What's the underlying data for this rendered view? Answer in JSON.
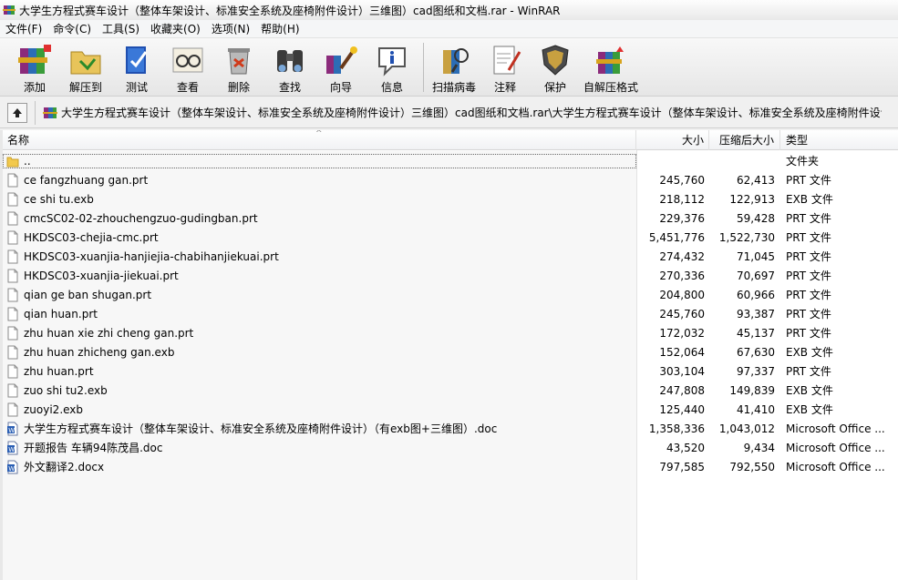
{
  "window": {
    "title": "大学生方程式赛车设计（整体车架设计、标准安全系统及座椅附件设计）三维图）cad图纸和文档.rar - WinRAR",
    "app_icon": "winrar-books-icon"
  },
  "menu": [
    "文件(F)",
    "命令(C)",
    "工具(S)",
    "收藏夹(O)",
    "选项(N)",
    "帮助(H)"
  ],
  "toolbar": {
    "buttons": [
      {
        "label": "添加",
        "icon": "add-books-icon"
      },
      {
        "label": "解压到",
        "icon": "extract-folder-icon"
      },
      {
        "label": "测试",
        "icon": "test-book-icon"
      },
      {
        "label": "查看",
        "icon": "view-glasses-icon"
      },
      {
        "label": "删除",
        "icon": "delete-recycle-icon"
      },
      {
        "label": "查找",
        "icon": "find-binoculars-icon"
      },
      {
        "label": "向导",
        "icon": "wizard-icon"
      },
      {
        "label": "信息",
        "icon": "info-icon"
      }
    ],
    "buttons2": [
      {
        "label": "扫描病毒",
        "icon": "scan-virus-icon"
      },
      {
        "label": "注释",
        "icon": "comment-icon"
      },
      {
        "label": "保护",
        "icon": "protect-shield-icon"
      },
      {
        "label": "自解压格式",
        "icon": "sfx-icon"
      }
    ]
  },
  "address": {
    "path": "大学生方程式赛车设计（整体车架设计、标准安全系统及座椅附件设计）三维图）cad图纸和文档.rar\\大学生方程式赛车设计（整体车架设计、标准安全系统及座椅附件设计"
  },
  "columns": {
    "name": "名称",
    "size": "大小",
    "packed": "压缩后大小",
    "type": "类型"
  },
  "files": [
    {
      "name": "..",
      "size": "",
      "packed": "",
      "type": "文件夹",
      "kind": "folder"
    },
    {
      "name": "ce fangzhuang gan.prt",
      "size": "245,760",
      "packed": "62,413",
      "type": "PRT 文件",
      "kind": "file"
    },
    {
      "name": "ce shi tu.exb",
      "size": "218,112",
      "packed": "122,913",
      "type": "EXB 文件",
      "kind": "file"
    },
    {
      "name": "cmcSC02-02-zhouchengzuo-gudingban.prt",
      "size": "229,376",
      "packed": "59,428",
      "type": "PRT 文件",
      "kind": "file"
    },
    {
      "name": "HKDSC03-chejia-cmc.prt",
      "size": "5,451,776",
      "packed": "1,522,730",
      "type": "PRT 文件",
      "kind": "file"
    },
    {
      "name": "HKDSC03-xuanjia-hanjiejia-chabihanjiekuai.prt",
      "size": "274,432",
      "packed": "71,045",
      "type": "PRT 文件",
      "kind": "file"
    },
    {
      "name": "HKDSC03-xuanjia-jiekuai.prt",
      "size": "270,336",
      "packed": "70,697",
      "type": "PRT 文件",
      "kind": "file"
    },
    {
      "name": "qian ge ban shugan.prt",
      "size": "204,800",
      "packed": "60,966",
      "type": "PRT 文件",
      "kind": "file"
    },
    {
      "name": "qian huan.prt",
      "size": "245,760",
      "packed": "93,387",
      "type": "PRT 文件",
      "kind": "file"
    },
    {
      "name": "zhu huan xie zhi cheng gan.prt",
      "size": "172,032",
      "packed": "45,137",
      "type": "PRT 文件",
      "kind": "file"
    },
    {
      "name": "zhu huan zhicheng gan.exb",
      "size": "152,064",
      "packed": "67,630",
      "type": "EXB 文件",
      "kind": "file"
    },
    {
      "name": "zhu huan.prt",
      "size": "303,104",
      "packed": "97,337",
      "type": "PRT 文件",
      "kind": "file"
    },
    {
      "name": "zuo shi tu2.exb",
      "size": "247,808",
      "packed": "149,839",
      "type": "EXB 文件",
      "kind": "file"
    },
    {
      "name": "zuoyi2.exb",
      "size": "125,440",
      "packed": "41,410",
      "type": "EXB 文件",
      "kind": "file"
    },
    {
      "name": "大学生方程式赛车设计（整体车架设计、标准安全系统及座椅附件设计）（有exb图+三维图）.doc",
      "size": "1,358,336",
      "packed": "1,043,012",
      "type": "Microsoft Office ...",
      "kind": "word"
    },
    {
      "name": "开题报告 车辆94陈茂昌.doc",
      "size": "43,520",
      "packed": "9,434",
      "type": "Microsoft Office ...",
      "kind": "word"
    },
    {
      "name": "外文翻译2.docx",
      "size": "797,585",
      "packed": "792,550",
      "type": "Microsoft Office ...",
      "kind": "word"
    }
  ]
}
